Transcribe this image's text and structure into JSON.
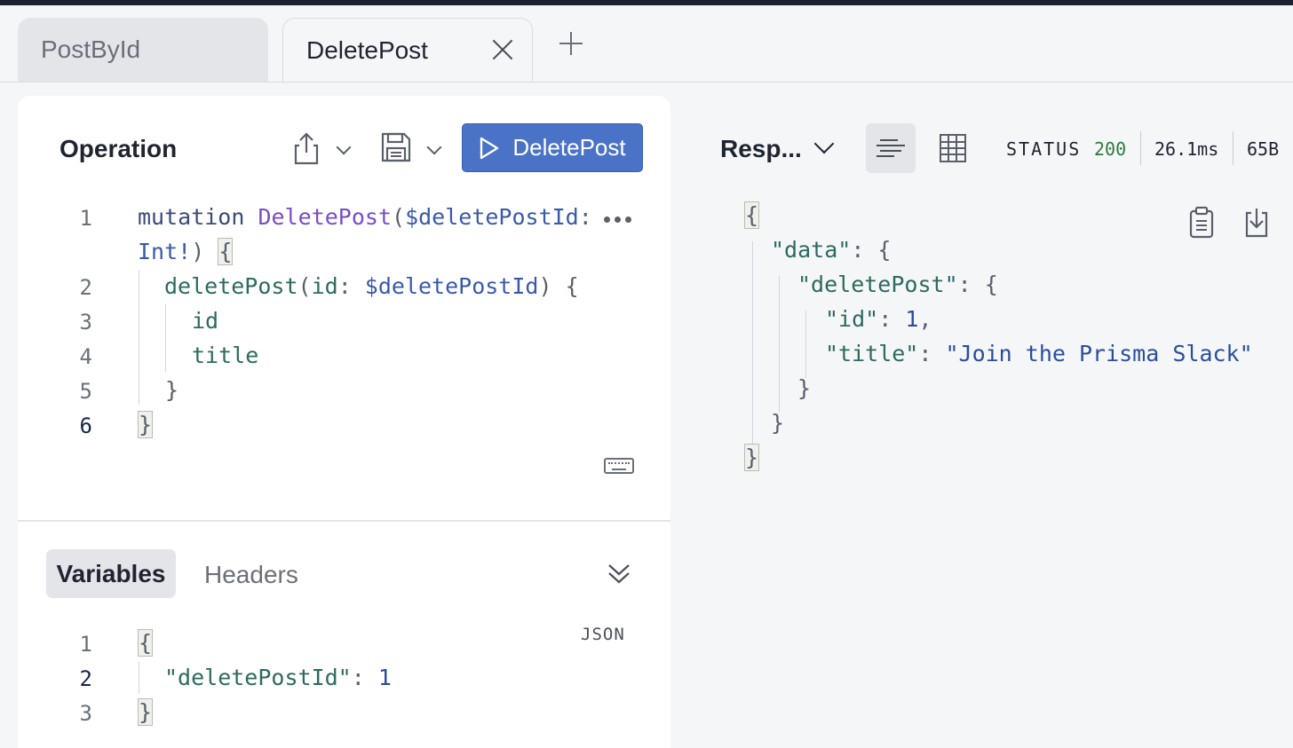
{
  "tabs": [
    {
      "label": "PostById",
      "active": false
    },
    {
      "label": "DeletePost",
      "active": true
    }
  ],
  "operation": {
    "title": "Operation",
    "run_label": "DeletePost",
    "code_line_numbers": [
      "1",
      "",
      "2",
      "3",
      "4",
      "5",
      "6"
    ],
    "code": {
      "l1_kw": "mutation",
      "l1_fn": "DeletePost",
      "l1_open": "(",
      "l1_var": "$deletePostId",
      "l1_colon": ":",
      "l2_type": "Int!",
      "l2_close": ")",
      "l2_brace": "{",
      "l3_field": "deletePost",
      "l3_open": "(",
      "l3_arg": "id",
      "l3_colon": ": ",
      "l3_var": "$deletePostId",
      "l3_close": ")",
      "l3_brace": "{",
      "l4": "id",
      "l5": "title",
      "l6": "}",
      "l7": "}"
    }
  },
  "variables": {
    "tab_active": "Variables",
    "tab_other": "Headers",
    "format_label": "JSON",
    "line_numbers": [
      "1",
      "2",
      "3"
    ],
    "open": "{",
    "key": "\"deletePostId\"",
    "colon": ": ",
    "value": "1",
    "close": "}"
  },
  "response": {
    "title": "Resp...",
    "status_label": "STATUS",
    "status_code": "200",
    "time": "26.1ms",
    "size": "65B",
    "json": {
      "open": "{",
      "data_key": "\"data\"",
      "data_open": ": {",
      "dp_key": "\"deletePost\"",
      "dp_open": ": {",
      "id_key": "\"id\"",
      "id_colon": ": ",
      "id_val": "1",
      "id_comma": ",",
      "title_key": "\"title\"",
      "title_colon": ": ",
      "title_val": "\"Join the Prisma Slack\"",
      "dp_close": "}",
      "data_close": "}",
      "close": "}"
    }
  },
  "colors": {
    "accent": "#4a72c7",
    "status_ok": "#2d7a3e"
  }
}
